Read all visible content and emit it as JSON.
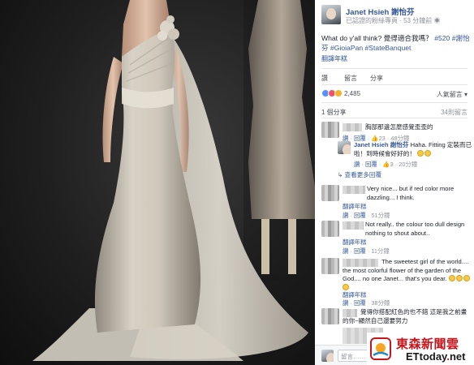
{
  "post": {
    "author": "Janet Hsieh 謝怡芬",
    "page_type": "已認證的粉絲專頁",
    "time": "53 分鐘前",
    "text_main": "What do y'all think? 覺得適合我嗎？",
    "hashtag_520": "#520",
    "hashtag_name": "#謝怡芬",
    "hashtag_gioia": "#GioiaPan",
    "hashtag_banquet": "#StateBanquet",
    "translate": "翻譯年糕",
    "actions": {
      "like": "讚",
      "comment": "留言",
      "share": "分享"
    },
    "reaction_count": "2,485",
    "sort": "人氣留言 ▾",
    "share_count": "1 個分享",
    "comment_count": "34則留言",
    "reaction_colors": [
      "#5890ff",
      "#f25268",
      "#f7b125"
    ]
  },
  "comments": [
    {
      "text": "胸部那邊怎麼感覺歪歪的",
      "like": "讚",
      "reply": "回覆",
      "likes": "23",
      "time": "48分鐘"
    },
    {
      "author": "Janet Hsieh 謝怡芬",
      "text": "Haha. Fitting 定裝而已啦！到時候會好好的！",
      "like": "讚",
      "reply": "回覆",
      "likes": "3",
      "time": "20分鐘",
      "more_replies": "查看更多回覆"
    },
    {
      "text": "Very nice... but if red color more dazzling... I think.",
      "translate": "翻譯年糕",
      "like": "讚",
      "reply": "回覆",
      "time": "51分鐘"
    },
    {
      "text": "Not really.. the colour too dull design nothing to shout about..",
      "translate": "翻譯年糕",
      "like": "讚",
      "reply": "回覆",
      "time": "11分鐘"
    },
    {
      "text": "The sweetest girl of the world.... the most colorful flower of the garden of the God.... no one Janet... that's you dear.",
      "translate": "翻譯年糕",
      "like": "讚",
      "reply": "回覆",
      "time": "38分鐘"
    },
    {
      "text": "覺得你搭配紅色的也不錯 這是我之前畫的你~顯然自己還要努力"
    }
  ],
  "compose": {
    "placeholder": "留言……"
  },
  "watermark": {
    "cn": "東森新聞雲",
    "en_a": "ETtoday",
    "en_dot": ".",
    "en_b": "net"
  },
  "colors": {
    "link": "#365899",
    "meta": "#90949c",
    "brand_red": "#c8161d"
  }
}
